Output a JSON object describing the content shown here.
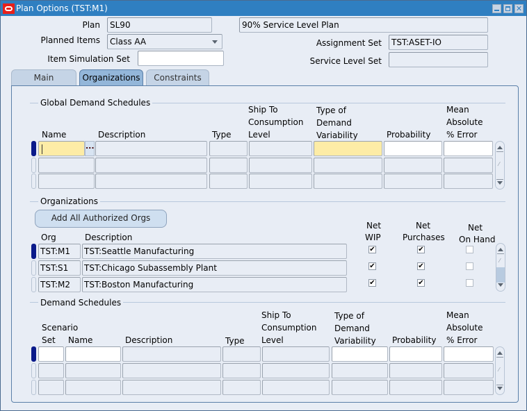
{
  "window": {
    "title": "Plan Options (TST:M1)",
    "controls": [
      "minimize",
      "maximize",
      "close"
    ]
  },
  "header": {
    "plan_label": "Plan",
    "plan_value": "SL90",
    "plan_description": "90% Service Level Plan",
    "planned_items_label": "Planned Items",
    "planned_items_value": "Class AA",
    "item_simulation_set_label": "Item Simulation Set",
    "item_simulation_set_value": "",
    "assignment_set_label": "Assignment Set",
    "assignment_set_value": "TST:ASET-IO",
    "service_level_set_label": "Service Level Set",
    "service_level_set_value": ""
  },
  "tabs": [
    {
      "label": "Main",
      "active": false
    },
    {
      "label": "Organizations",
      "active": true
    },
    {
      "label": "Constraints",
      "active": false
    }
  ],
  "global_demand_schedules": {
    "title": "Global Demand Schedules",
    "columns": {
      "name": "Name",
      "description": "Description",
      "type": "Type",
      "ship_to_1": "Ship To",
      "ship_to_2": "Consumption",
      "ship_to_3": "Level",
      "tdv_1": "Type of",
      "tdv_2": "Demand",
      "tdv_3": "Variability",
      "probability": "Probability",
      "mape_1": "Mean",
      "mape_2": "Absolute",
      "mape_3": "% Error"
    },
    "lov_label": "...",
    "rows": [
      {
        "name": "",
        "description": "",
        "type": "",
        "ship_to": "",
        "variability": "",
        "probability": "",
        "mape": ""
      },
      {
        "name": "",
        "description": "",
        "type": "",
        "ship_to": "",
        "variability": "",
        "probability": "",
        "mape": ""
      },
      {
        "name": "",
        "description": "",
        "type": "",
        "ship_to": "",
        "variability": "",
        "probability": "",
        "mape": ""
      }
    ]
  },
  "organizations": {
    "title": "Organizations",
    "add_button": "Add All Authorized Orgs",
    "columns": {
      "org": "Org",
      "description": "Description",
      "net_wip_1": "Net",
      "net_wip_2": "WIP",
      "net_purchases_1": "Net",
      "net_purchases_2": "Purchases",
      "net_on_hand_1": "Net",
      "net_on_hand_2": "On Hand"
    },
    "rows": [
      {
        "org": "TST:M1",
        "description": "TST:Seattle Manufacturing",
        "net_wip": true,
        "net_purchases": true,
        "net_on_hand": false
      },
      {
        "org": "TST:S1",
        "description": "TST:Chicago Subassembly Plant",
        "net_wip": true,
        "net_purchases": true,
        "net_on_hand": false
      },
      {
        "org": "TST:M2",
        "description": "TST:Boston Manufacturing",
        "net_wip": true,
        "net_purchases": true,
        "net_on_hand": false
      }
    ]
  },
  "demand_schedules": {
    "title": "Demand Schedules",
    "columns": {
      "scenario_1": "Scenario",
      "scenario_2": "Set",
      "name": "Name",
      "description": "Description",
      "type": "Type",
      "ship_to_1": "Ship To",
      "ship_to_2": "Consumption",
      "ship_to_3": "Level",
      "tdv_1": "Type of",
      "tdv_2": "Demand",
      "tdv_3": "Variability",
      "probability": "Probability",
      "mape_1": "Mean",
      "mape_2": "Absolute",
      "mape_3": "% Error"
    },
    "rows": [
      {
        "scenario_set": "",
        "name": "",
        "description": "",
        "type": "",
        "ship_to": "",
        "variability": "",
        "probability": "",
        "mape": ""
      },
      {
        "scenario_set": "",
        "name": "",
        "description": "",
        "type": "",
        "ship_to": "",
        "variability": "",
        "probability": "",
        "mape": ""
      },
      {
        "scenario_set": "",
        "name": "",
        "description": "",
        "type": "",
        "ship_to": "",
        "variability": "",
        "probability": "",
        "mape": ""
      }
    ]
  },
  "icons": {
    "check": "✔",
    "close": "✕"
  }
}
